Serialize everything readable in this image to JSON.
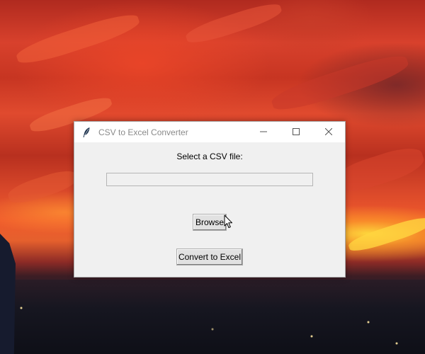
{
  "window": {
    "title": "CSV to Excel Converter",
    "app_icon": "feather-icon",
    "controls": {
      "minimize_icon": "minimize-icon",
      "maximize_icon": "maximize-icon",
      "close_icon": "close-icon"
    }
  },
  "form": {
    "prompt_label": "Select a CSV file:",
    "file_path_value": "",
    "browse_label": "Browse",
    "convert_label": "Convert to Excel"
  },
  "colors": {
    "window_background": "#f0f0f0",
    "titlebar_background": "#ffffff",
    "button_background": "#e1e1e1"
  }
}
